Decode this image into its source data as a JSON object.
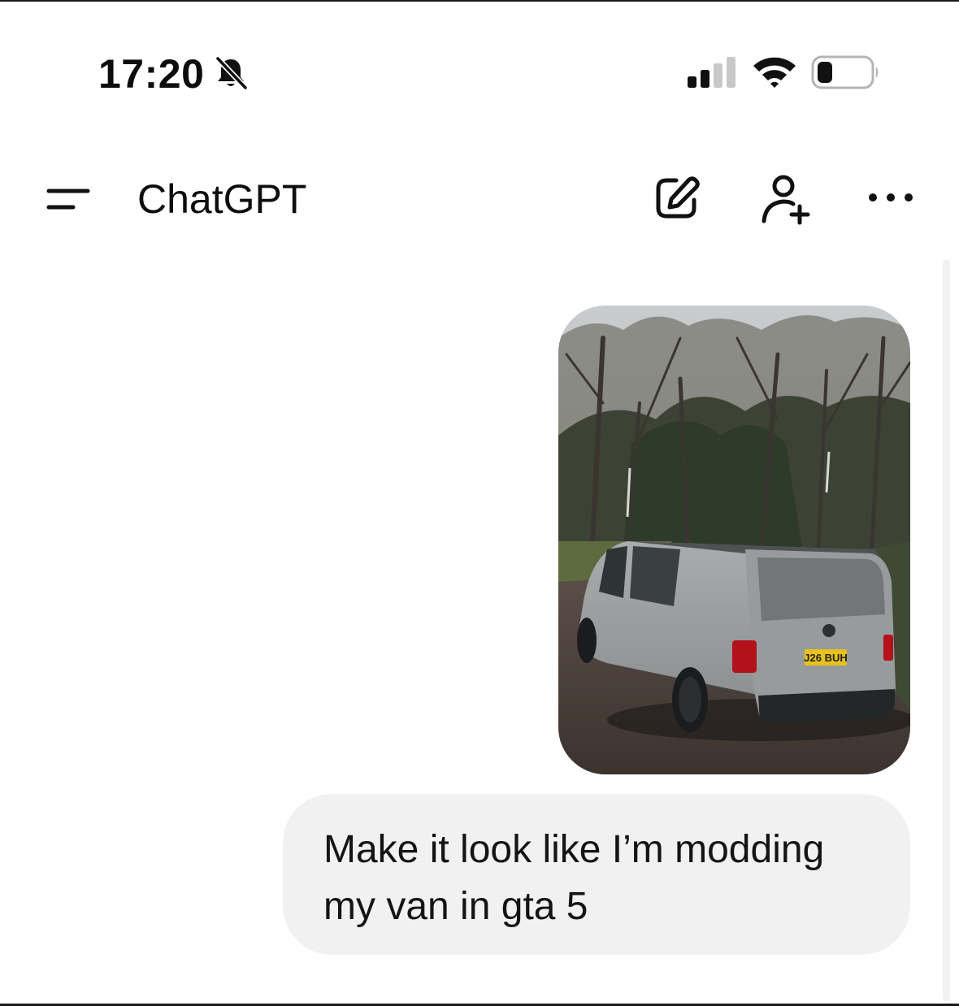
{
  "status_bar": {
    "time": "17:20",
    "silent_icon": "bell-slash-icon",
    "signal_icon": "cellular-signal-icon",
    "wifi_icon": "wifi-icon",
    "battery_icon": "battery-icon",
    "battery_level": 0.2,
    "signal_bars_active": 2,
    "signal_bars_total": 4
  },
  "header": {
    "title": "ChatGPT",
    "menu_icon": "sidebar-menu-icon",
    "new_chat_icon": "edit-icon",
    "add_people_icon": "person-add-icon",
    "more_icon": "more-options-icon"
  },
  "conversation": {
    "user_image": "photo of a grey van parked on a gravel path in front of bare trees",
    "user_message": "Make it look like I’m modding my van in gta 5"
  },
  "colors": {
    "background": "#ffffff",
    "bubble_background": "#f1f1f1",
    "text": "#0d0d0d",
    "scrollbar_track": "#f1f1f1"
  }
}
